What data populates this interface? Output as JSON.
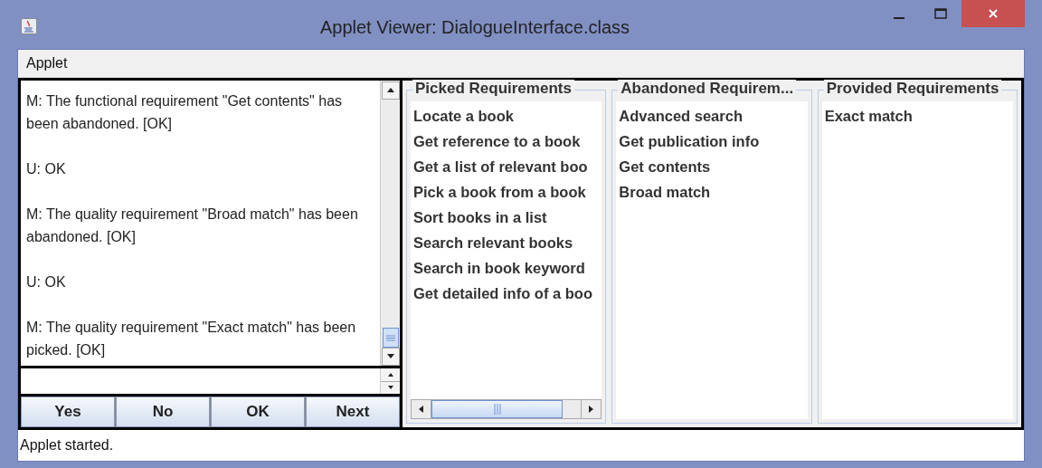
{
  "window": {
    "title": "Applet Viewer: DialogueInterface.class"
  },
  "menu": [
    "Applet"
  ],
  "dialogue": {
    "messages": [
      "M: The functional requirement \"Get contents\" has been abandoned. [OK]",
      "U: OK",
      "M: The quality requirement \"Broad match\" has been abandoned. [OK]",
      "U: OK",
      "M: The quality requirement \"Exact match\" has been picked. [OK]"
    ],
    "buttons": [
      "Yes",
      "No",
      "OK",
      "Next"
    ]
  },
  "groups": [
    {
      "title": "Picked Requirements",
      "items": [
        "Locate a book",
        "Get reference to a book",
        "Get a list of relevant boo",
        "Pick a book from a book",
        "Sort books in a list",
        "Search relevant books",
        "Search in book keyword",
        "Get detailed info of a boo"
      ],
      "h_scrollbar": true
    },
    {
      "title": "Abandoned Requirem...",
      "items": [
        "Advanced search",
        "Get publication info",
        "Get contents",
        "Broad match"
      ],
      "h_scrollbar": false
    },
    {
      "title": "Provided Requirements",
      "items": [
        "Exact match"
      ],
      "h_scrollbar": false
    }
  ],
  "status_bar": "Applet started."
}
